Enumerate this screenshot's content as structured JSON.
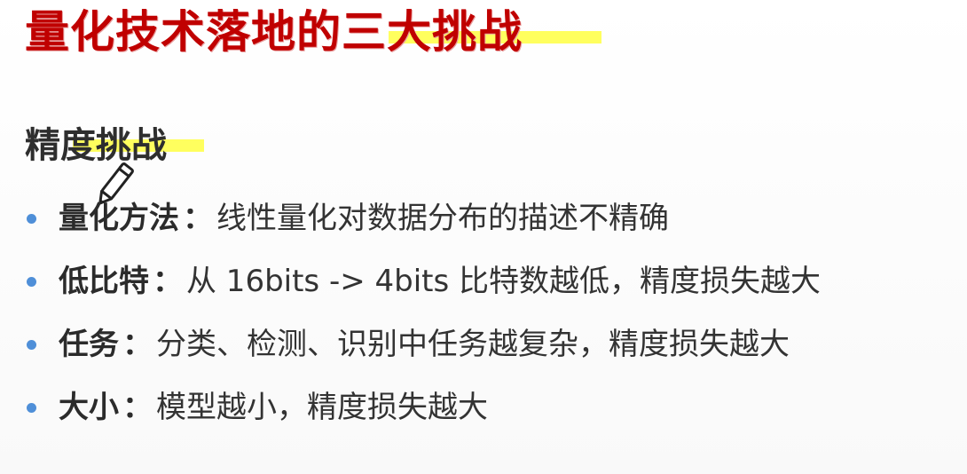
{
  "slide": {
    "title": "量化技术落地的三大挑战",
    "heading": "精度挑战",
    "separator": "：",
    "bullets": [
      {
        "term": "量化方法",
        "text": "线性量化对数据分布的描述不精确"
      },
      {
        "term": "低比特",
        "text": "从 16bits -> 4bits 比特数越低，精度损失越大"
      },
      {
        "term": "任务",
        "text": "分类、检测、识别中任务越复杂，精度损失越大"
      },
      {
        "term": "大小",
        "text": "模型越小，精度损失越大"
      }
    ]
  },
  "colors": {
    "title": "#c00000",
    "bullet_dot": "#4f8fd8",
    "highlight": "#ffff28",
    "body_text": "#333333"
  },
  "icons": {
    "annotation": "pencil-icon",
    "list_marker": "bullet-dot-icon"
  }
}
